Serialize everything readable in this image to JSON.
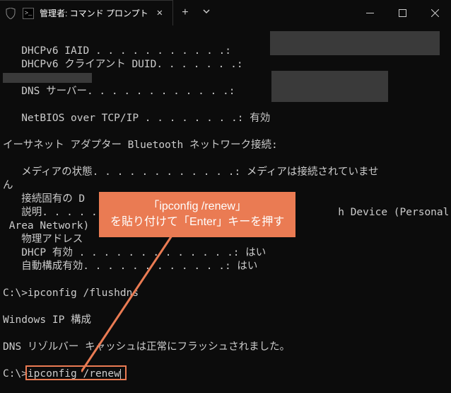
{
  "titlebar": {
    "tab_title": "管理者: コマンド プロンプト"
  },
  "terminal": {
    "l1a": "   DHCPv6 IAID . . . . . . . . . . .:",
    "l1b": "   DHCPv6 クライアント DUID. . . . . . .:",
    "l2": "   DNS サーバー. . . . . . . . . . . .:",
    "l3": "   NetBIOS over TCP/IP . . . . . . . .: 有効",
    "l4": "イーサネット アダプター Bluetooth ネットワーク接続:",
    "l5a": "   メディアの状態. . . . . . . . . . . .: メディアは接続されていませ",
    "l5b": "ん",
    "l6": "   接続固有の D",
    "l7a": "   説明. . . . .",
    "l7b": "h Device (Personal",
    "l7c": " Area Network)",
    "l8": "   物理アドレス",
    "l9": "   DHCP 有効 . . . . . . . . . . . . .: はい",
    "l10": "   自動構成有効. . . . . . . . . . . .: はい",
    "l11": "C:\\>ipconfig /flushdns",
    "l12": "Windows IP 構成",
    "l13": "DNS リゾルバー キャッシュは正常にフラッシュされました。",
    "l14a": "C:\\>",
    "l14b": "ipconfig /renew"
  },
  "callout": {
    "line1": "「ipconfig /renew」",
    "line2": "を貼り付けて「Enter」キーを押す"
  }
}
